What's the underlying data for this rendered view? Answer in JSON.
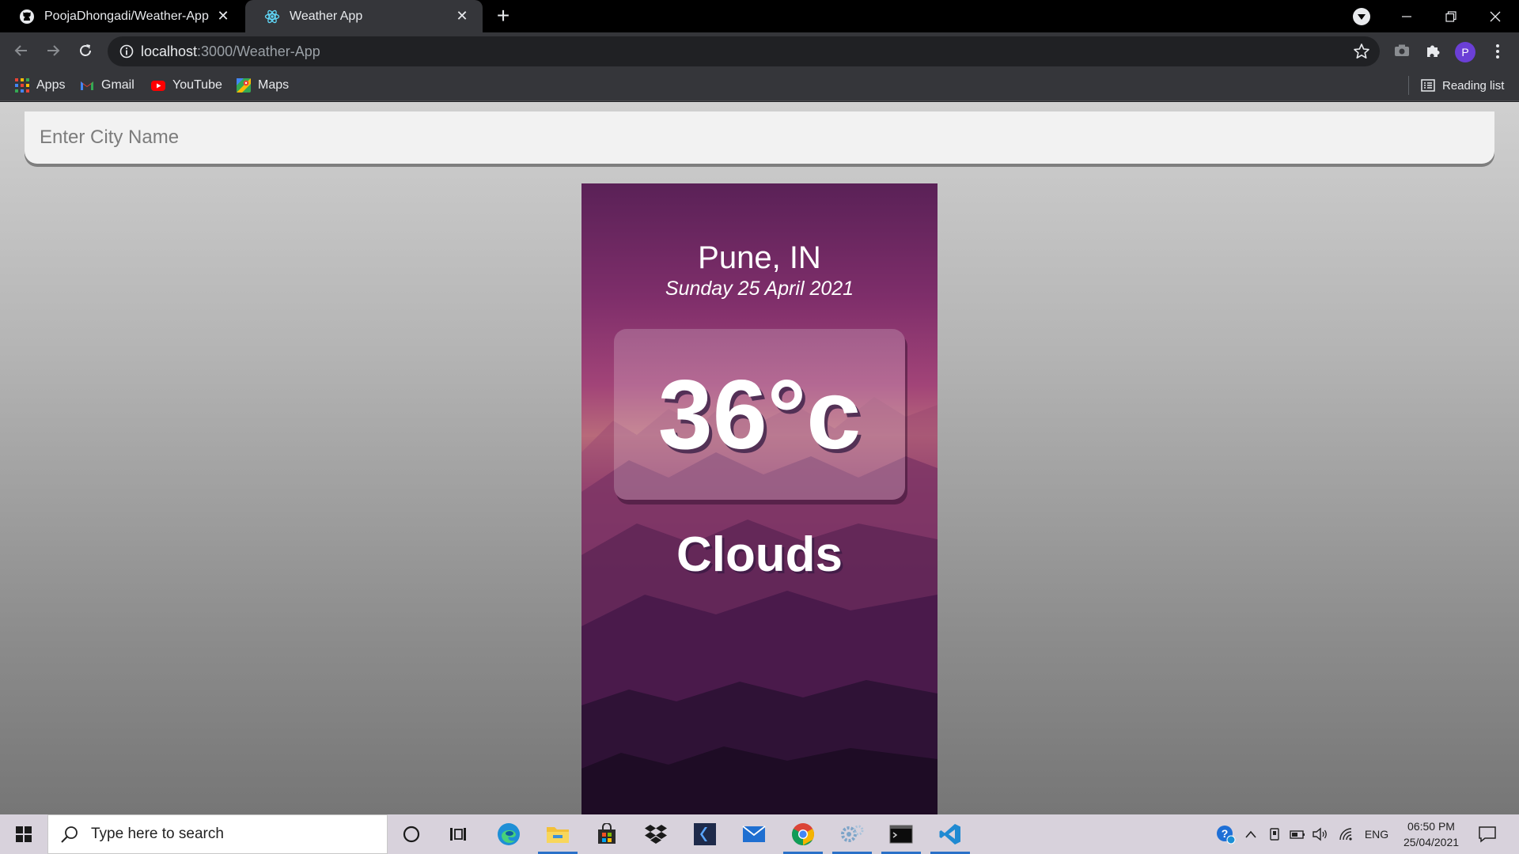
{
  "browser": {
    "tabs": [
      {
        "title": "PoojaDhongadi/Weather-App: W",
        "favicon": "github-icon",
        "active": false
      },
      {
        "title": "Weather App",
        "favicon": "react-icon",
        "active": true
      }
    ],
    "url_host": "localhost",
    "url_path": ":3000/Weather-App",
    "bookmarks": [
      {
        "label": "Apps",
        "icon": "apps-grid-icon"
      },
      {
        "label": "Gmail",
        "icon": "gmail-icon"
      },
      {
        "label": "YouTube",
        "icon": "youtube-icon"
      },
      {
        "label": "Maps",
        "icon": "maps-icon"
      }
    ],
    "reading_list": "Reading list",
    "profile_initial": "P"
  },
  "app": {
    "search_placeholder": "Enter City Name",
    "location": "Pune, IN",
    "date": "Sunday 25 April 2021",
    "temperature": "36°c",
    "condition": "Clouds"
  },
  "taskbar": {
    "search_placeholder": "Type here to search",
    "pinned": [
      "cortana-icon",
      "task-view-icon",
      "edge-icon",
      "file-explorer-icon",
      "store-icon",
      "dropbox-icon",
      "visual-studio-icon",
      "mail-icon",
      "chrome-icon",
      "settings-app-icon",
      "terminal-icon",
      "vscode-icon"
    ],
    "language": "ENG",
    "time": "06:50 PM",
    "date": "25/04/2021"
  },
  "colors": {
    "accent_taskbar": "#2a70c8",
    "card_top": "#5a2157",
    "card_bottom": "#1b0f24"
  }
}
